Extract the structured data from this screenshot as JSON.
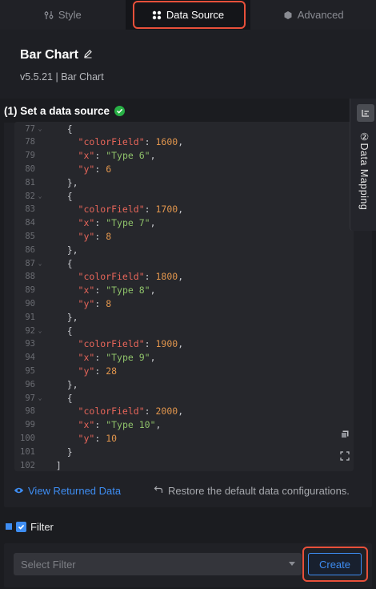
{
  "tabs": [
    {
      "label": "Style",
      "icon": "style-sliders-icon"
    },
    {
      "label": "Data Source",
      "icon": "data-source-grid-icon"
    },
    {
      "label": "Advanced",
      "icon": "advanced-hexagon-icon"
    }
  ],
  "header": {
    "title": "Bar Chart",
    "subtitle": "v5.5.21 | Bar Chart"
  },
  "data_source": {
    "title": "(1) Set a data source",
    "status_color": "#28b045"
  },
  "editor": {
    "lines": [
      {
        "n": "77",
        "fold": true,
        "indent": "    ",
        "type": "brace",
        "text": "{"
      },
      {
        "n": "78",
        "fold": false,
        "indent": "      ",
        "type": "kv",
        "key": "\"colorField\"",
        "value": "1600",
        "vtype": "num",
        "comma": true
      },
      {
        "n": "79",
        "fold": false,
        "indent": "      ",
        "type": "kv",
        "key": "\"x\"",
        "value": "\"Type 6\"",
        "vtype": "str",
        "comma": true
      },
      {
        "n": "80",
        "fold": false,
        "indent": "      ",
        "type": "kv",
        "key": "\"y\"",
        "value": "6",
        "vtype": "num",
        "comma": false
      },
      {
        "n": "81",
        "fold": false,
        "indent": "    ",
        "type": "brace",
        "text": "},"
      },
      {
        "n": "82",
        "fold": true,
        "indent": "    ",
        "type": "brace",
        "text": "{"
      },
      {
        "n": "83",
        "fold": false,
        "indent": "      ",
        "type": "kv",
        "key": "\"colorField\"",
        "value": "1700",
        "vtype": "num",
        "comma": true
      },
      {
        "n": "84",
        "fold": false,
        "indent": "      ",
        "type": "kv",
        "key": "\"x\"",
        "value": "\"Type 7\"",
        "vtype": "str",
        "comma": true
      },
      {
        "n": "85",
        "fold": false,
        "indent": "      ",
        "type": "kv",
        "key": "\"y\"",
        "value": "8",
        "vtype": "num",
        "comma": false
      },
      {
        "n": "86",
        "fold": false,
        "indent": "    ",
        "type": "brace",
        "text": "},"
      },
      {
        "n": "87",
        "fold": true,
        "indent": "    ",
        "type": "brace",
        "text": "{"
      },
      {
        "n": "88",
        "fold": false,
        "indent": "      ",
        "type": "kv",
        "key": "\"colorField\"",
        "value": "1800",
        "vtype": "num",
        "comma": true
      },
      {
        "n": "89",
        "fold": false,
        "indent": "      ",
        "type": "kv",
        "key": "\"x\"",
        "value": "\"Type 8\"",
        "vtype": "str",
        "comma": true
      },
      {
        "n": "90",
        "fold": false,
        "indent": "      ",
        "type": "kv",
        "key": "\"y\"",
        "value": "8",
        "vtype": "num",
        "comma": false
      },
      {
        "n": "91",
        "fold": false,
        "indent": "    ",
        "type": "brace",
        "text": "},"
      },
      {
        "n": "92",
        "fold": true,
        "indent": "    ",
        "type": "brace",
        "text": "{"
      },
      {
        "n": "93",
        "fold": false,
        "indent": "      ",
        "type": "kv",
        "key": "\"colorField\"",
        "value": "1900",
        "vtype": "num",
        "comma": true
      },
      {
        "n": "94",
        "fold": false,
        "indent": "      ",
        "type": "kv",
        "key": "\"x\"",
        "value": "\"Type 9\"",
        "vtype": "str",
        "comma": true
      },
      {
        "n": "95",
        "fold": false,
        "indent": "      ",
        "type": "kv",
        "key": "\"y\"",
        "value": "28",
        "vtype": "num",
        "comma": false
      },
      {
        "n": "96",
        "fold": false,
        "indent": "    ",
        "type": "brace",
        "text": "},"
      },
      {
        "n": "97",
        "fold": true,
        "indent": "    ",
        "type": "brace",
        "text": "{"
      },
      {
        "n": "98",
        "fold": false,
        "indent": "      ",
        "type": "kv",
        "key": "\"colorField\"",
        "value": "2000",
        "vtype": "num",
        "comma": true
      },
      {
        "n": "99",
        "fold": false,
        "indent": "      ",
        "type": "kv",
        "key": "\"x\"",
        "value": "\"Type 10\"",
        "vtype": "str",
        "comma": true
      },
      {
        "n": "100",
        "fold": false,
        "indent": "      ",
        "type": "kv",
        "key": "\"y\"",
        "value": "10",
        "vtype": "num",
        "comma": false
      },
      {
        "n": "101",
        "fold": false,
        "indent": "    ",
        "type": "brace",
        "text": "}"
      },
      {
        "n": "102",
        "fold": false,
        "indent": "  ",
        "type": "brace",
        "text": "]"
      }
    ]
  },
  "side_panel": {
    "label": "②Data Mapping",
    "icon": "data-mapping-icon"
  },
  "links": {
    "view": "View Returned Data",
    "restore": "Restore the default data configurations."
  },
  "filter": {
    "label": "Filter",
    "checked": true,
    "placeholder": "Select Filter",
    "create": "Create"
  },
  "colors": {
    "accent": "#3e8df2",
    "highlight": "#e8503a",
    "success": "#28b045"
  }
}
